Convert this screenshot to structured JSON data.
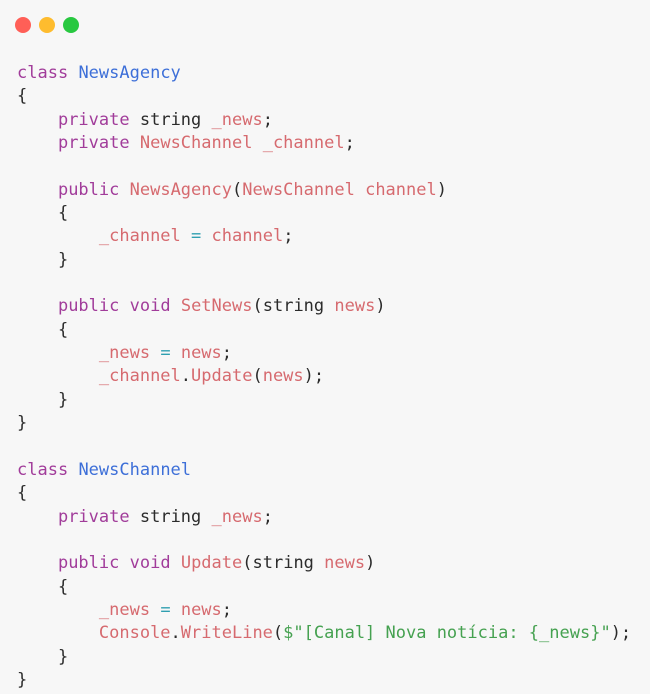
{
  "window": {
    "buttons": [
      {
        "name": "close",
        "color": "#ff5f57"
      },
      {
        "name": "minimize",
        "color": "#febc2e"
      },
      {
        "name": "maximize",
        "color": "#28c840"
      }
    ]
  },
  "code": {
    "lines": [
      [
        [
          "keyword",
          "class"
        ],
        [
          "text",
          " "
        ],
        [
          "class-name",
          "NewsAgency"
        ]
      ],
      [
        [
          "punct",
          "{"
        ]
      ],
      [
        [
          "text",
          "    "
        ],
        [
          "keyword",
          "private"
        ],
        [
          "text",
          " "
        ],
        [
          "type",
          "string"
        ],
        [
          "text",
          " "
        ],
        [
          "ident",
          "_news"
        ],
        [
          "punct",
          ";"
        ]
      ],
      [
        [
          "text",
          "    "
        ],
        [
          "keyword",
          "private"
        ],
        [
          "text",
          " "
        ],
        [
          "ident",
          "NewsChannel"
        ],
        [
          "text",
          " "
        ],
        [
          "ident",
          "_channel"
        ],
        [
          "punct",
          ";"
        ]
      ],
      [],
      [
        [
          "text",
          "    "
        ],
        [
          "keyword",
          "public"
        ],
        [
          "text",
          " "
        ],
        [
          "ident",
          "NewsAgency"
        ],
        [
          "punct",
          "("
        ],
        [
          "ident",
          "NewsChannel"
        ],
        [
          "text",
          " "
        ],
        [
          "ident",
          "channel"
        ],
        [
          "punct",
          ")"
        ]
      ],
      [
        [
          "text",
          "    "
        ],
        [
          "punct",
          "{"
        ]
      ],
      [
        [
          "text",
          "        "
        ],
        [
          "ident",
          "_channel"
        ],
        [
          "text",
          " "
        ],
        [
          "operator",
          "="
        ],
        [
          "text",
          " "
        ],
        [
          "ident",
          "channel"
        ],
        [
          "punct",
          ";"
        ]
      ],
      [
        [
          "text",
          "    "
        ],
        [
          "punct",
          "}"
        ]
      ],
      [],
      [
        [
          "text",
          "    "
        ],
        [
          "keyword",
          "public"
        ],
        [
          "text",
          " "
        ],
        [
          "keyword",
          "void"
        ],
        [
          "text",
          " "
        ],
        [
          "ident",
          "SetNews"
        ],
        [
          "punct",
          "("
        ],
        [
          "type",
          "string"
        ],
        [
          "text",
          " "
        ],
        [
          "ident",
          "news"
        ],
        [
          "punct",
          ")"
        ]
      ],
      [
        [
          "text",
          "    "
        ],
        [
          "punct",
          "{"
        ]
      ],
      [
        [
          "text",
          "        "
        ],
        [
          "ident",
          "_news"
        ],
        [
          "text",
          " "
        ],
        [
          "operator",
          "="
        ],
        [
          "text",
          " "
        ],
        [
          "ident",
          "news"
        ],
        [
          "punct",
          ";"
        ]
      ],
      [
        [
          "text",
          "        "
        ],
        [
          "ident",
          "_channel"
        ],
        [
          "punct",
          "."
        ],
        [
          "ident",
          "Update"
        ],
        [
          "punct",
          "("
        ],
        [
          "ident",
          "news"
        ],
        [
          "punct",
          ");"
        ]
      ],
      [
        [
          "text",
          "    "
        ],
        [
          "punct",
          "}"
        ]
      ],
      [
        [
          "punct",
          "}"
        ]
      ],
      [],
      [
        [
          "keyword",
          "class"
        ],
        [
          "text",
          " "
        ],
        [
          "class-name",
          "NewsChannel"
        ]
      ],
      [
        [
          "punct",
          "{"
        ]
      ],
      [
        [
          "text",
          "    "
        ],
        [
          "keyword",
          "private"
        ],
        [
          "text",
          " "
        ],
        [
          "type",
          "string"
        ],
        [
          "text",
          " "
        ],
        [
          "ident",
          "_news"
        ],
        [
          "punct",
          ";"
        ]
      ],
      [],
      [
        [
          "text",
          "    "
        ],
        [
          "keyword",
          "public"
        ],
        [
          "text",
          " "
        ],
        [
          "keyword",
          "void"
        ],
        [
          "text",
          " "
        ],
        [
          "ident",
          "Update"
        ],
        [
          "punct",
          "("
        ],
        [
          "type",
          "string"
        ],
        [
          "text",
          " "
        ],
        [
          "ident",
          "news"
        ],
        [
          "punct",
          ")"
        ]
      ],
      [
        [
          "text",
          "    "
        ],
        [
          "punct",
          "{"
        ]
      ],
      [
        [
          "text",
          "        "
        ],
        [
          "ident",
          "_news"
        ],
        [
          "text",
          " "
        ],
        [
          "operator",
          "="
        ],
        [
          "text",
          " "
        ],
        [
          "ident",
          "news"
        ],
        [
          "punct",
          ";"
        ]
      ],
      [
        [
          "text",
          "        "
        ],
        [
          "ident",
          "Console"
        ],
        [
          "punct",
          "."
        ],
        [
          "ident",
          "WriteLine"
        ],
        [
          "punct",
          "("
        ],
        [
          "string",
          "$\"[Canal] Nova notícia: {_news}\""
        ],
        [
          "punct",
          ");"
        ]
      ],
      [
        [
          "text",
          "    "
        ],
        [
          "punct",
          "}"
        ]
      ],
      [
        [
          "punct",
          "}"
        ]
      ]
    ]
  }
}
